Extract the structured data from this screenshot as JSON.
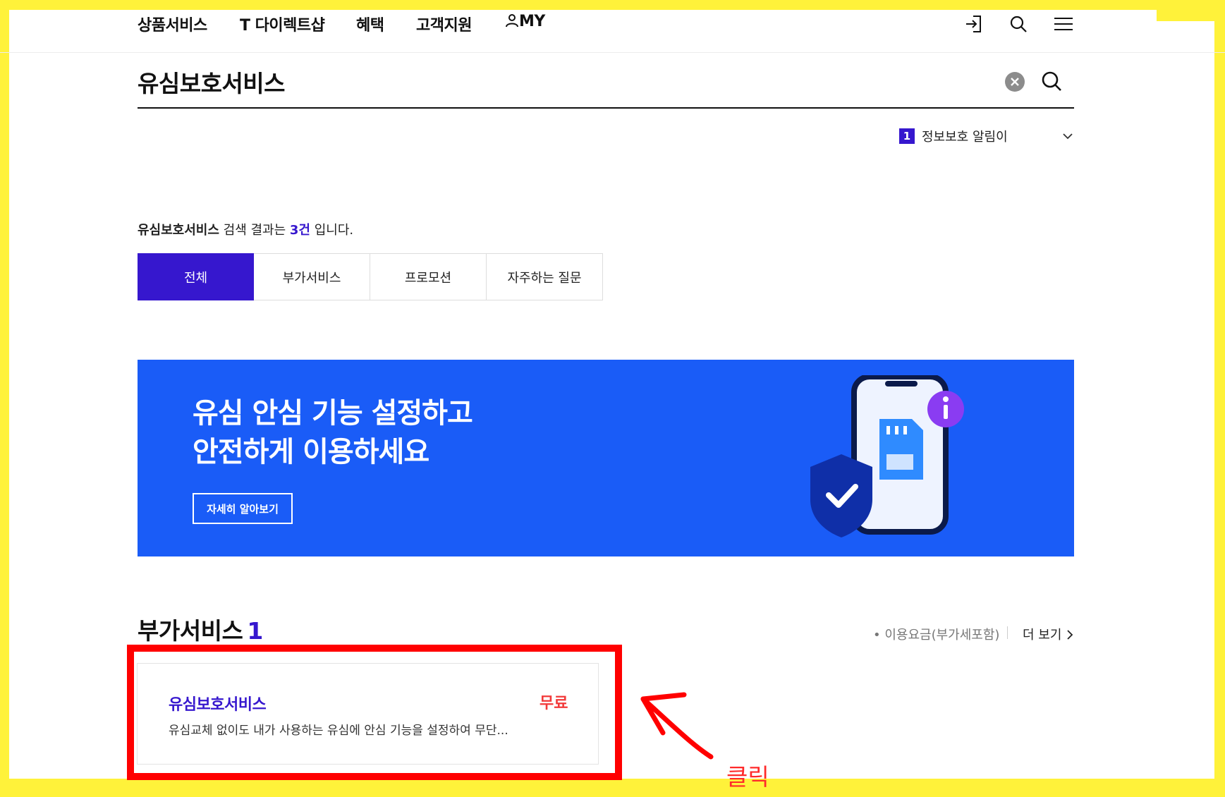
{
  "gnb": {
    "items": [
      "상품서비스",
      "T 다이렉트샵",
      "혜택",
      "고객지원",
      "MY"
    ]
  },
  "search": {
    "term": "유심보호서비스"
  },
  "notice": {
    "rank": "1",
    "text": "정보보호 알림이"
  },
  "summary": {
    "keyword": "유심보호서비스",
    "mid": " 검색 결과는 ",
    "count": "3건",
    "tail": " 입니다."
  },
  "tabs": [
    "전체",
    "부가서비스",
    "프로모션",
    "자주하는 질문"
  ],
  "banner": {
    "line1": "유심 안심 기능 설정하고",
    "line2": "안전하게 이용하세요",
    "button": "자세히 알아보기",
    "bg_color": "#1a5cf7"
  },
  "section": {
    "title": "부가서비스",
    "count": "1",
    "fee_note": "• 이용요금(부가세포함)",
    "more": "더 보기"
  },
  "card": {
    "title": "유심보호서비스",
    "price": "무료",
    "desc": "유심교체 없이도 내가 사용하는 유심에 안심 기능을 설정하여 무단..."
  },
  "annotation": {
    "label": "클릭"
  },
  "colors": {
    "accent": "#3617ce",
    "price": "#f23a3a",
    "annotation": "#ff0000",
    "frame": "#fff23a"
  }
}
